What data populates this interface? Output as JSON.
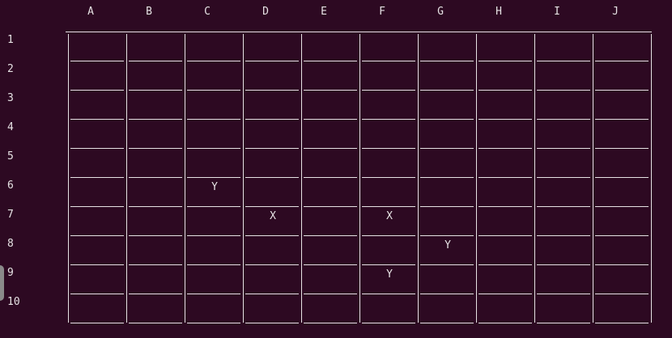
{
  "board": {
    "columns": [
      "A",
      "B",
      "C",
      "D",
      "E",
      "F",
      "G",
      "H",
      "I",
      "J"
    ],
    "rows": [
      "1",
      "2",
      "3",
      "4",
      "5",
      "6",
      "7",
      "8",
      "9",
      "10"
    ],
    "marks": [
      {
        "row": 6,
        "col": "C",
        "symbol": "Y"
      },
      {
        "row": 7,
        "col": "D",
        "symbol": "X"
      },
      {
        "row": 7,
        "col": "F",
        "symbol": "X"
      },
      {
        "row": 8,
        "col": "G",
        "symbol": "Y"
      },
      {
        "row": 9,
        "col": "F",
        "symbol": "Y"
      }
    ]
  },
  "colors": {
    "background": "#2d0922",
    "foreground": "#e6e2e4"
  }
}
